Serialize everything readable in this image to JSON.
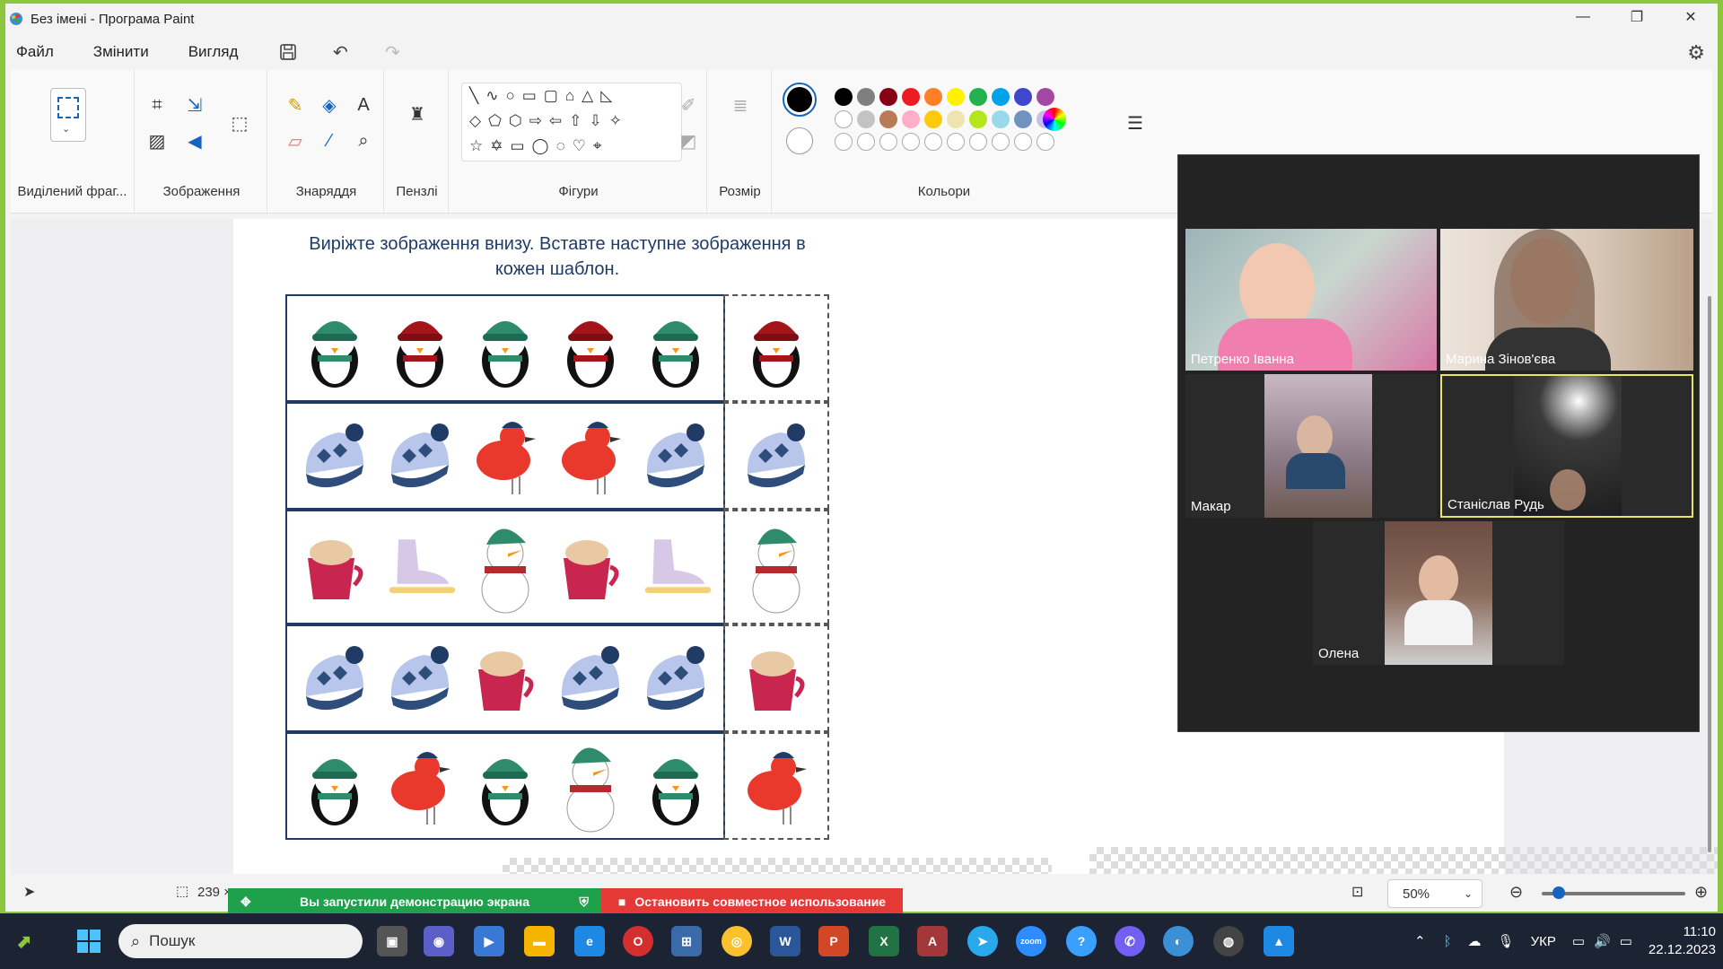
{
  "window": {
    "title": "Без імені - Програма Paint"
  },
  "menu": {
    "file": "Файл",
    "edit": "Змінити",
    "view": "Вигляд"
  },
  "ribbon": {
    "selection_label": "Виділений фраг...",
    "image_label": "Зображення",
    "tools_label": "Знаряддя",
    "brushes_label": "Пензлі",
    "shapes_label": "Фігури",
    "size_label": "Розмір",
    "colors_label": "Кольори",
    "palette": [
      "#000000",
      "#7f7f7f",
      "#880015",
      "#ed1c24",
      "#ff7f27",
      "#fff200",
      "#22b14c",
      "#00a2e8",
      "#3f48cc",
      "#a349a4"
    ],
    "palette2": [
      "#ffffff",
      "#c3c3c3",
      "#b97a57",
      "#ffaec9",
      "#ffc90e",
      "#efe4b0",
      "#b5e61d",
      "#99d9ea",
      "#7092be",
      "#c8bfe7"
    ]
  },
  "canvas": {
    "instruction_line1": "Виріжте зображення внизу. Вставте наступне зображення в",
    "instruction_line2": "кожен шаблон."
  },
  "status": {
    "size_text": "239 ×",
    "zoom": "50%"
  },
  "share": {
    "started": "Вы запустили демонстрацию экрана",
    "stop": "Остановить совместное использование"
  },
  "participants": [
    "Петренко Іванна",
    "Марина Зінов'єва",
    "Макар",
    "Станіслав Рудь",
    "Олена"
  ],
  "taskbar": {
    "search": "Пошук",
    "lang": "УКР",
    "time": "11:10",
    "date": "22.12.2023"
  }
}
